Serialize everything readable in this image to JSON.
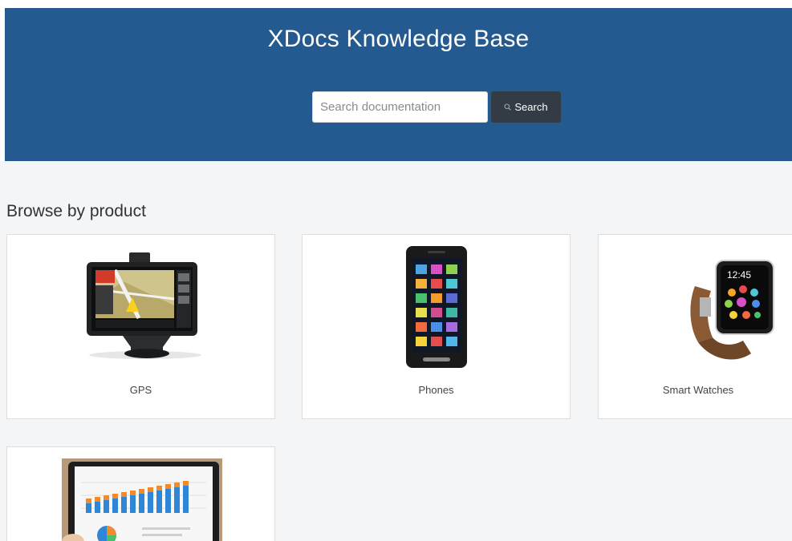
{
  "header": {
    "title": "XDocs Knowledge Base",
    "search": {
      "placeholder": "Search documentation",
      "value": "",
      "button_label": "Search",
      "button_icon": "search-icon"
    }
  },
  "main": {
    "section_title": "Browse by product",
    "products": [
      {
        "label": "GPS",
        "icon": "gps-device-image"
      },
      {
        "label": "Phones",
        "icon": "smartphone-image"
      },
      {
        "label": "Smart Watches",
        "icon": "smartwatch-image"
      },
      {
        "label": "",
        "icon": "tablet-chart-image"
      }
    ]
  },
  "colors": {
    "header_bg": "#245a8f",
    "button_bg": "#333b44",
    "content_bg": "#f4f5f7"
  }
}
